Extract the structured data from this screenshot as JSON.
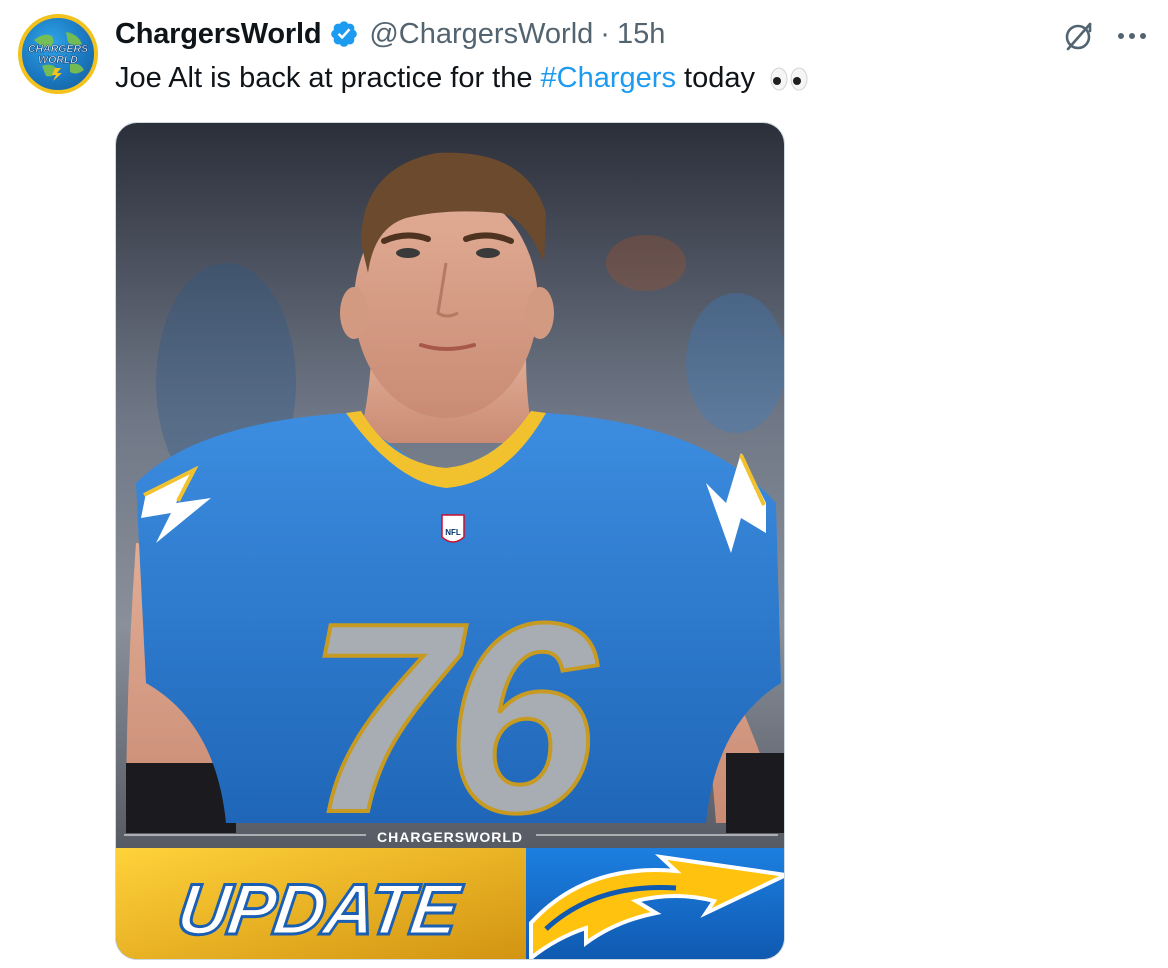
{
  "tweet": {
    "display_name": "ChargersWorld",
    "handle": "@ChargersWorld",
    "separator": "·",
    "time": "15h",
    "text_before": "Joe Alt is back at practice for the ",
    "hashtag": "#Chargers",
    "text_after": " today",
    "emoji": "eyes-emoji"
  },
  "avatar": {
    "line1": "CHARGERS",
    "line2": "WORLD",
    "icon": "globe-logo"
  },
  "icons": {
    "verified": "verified-badge-icon",
    "grok": "grok-icon",
    "more": "more-options-icon"
  },
  "media": {
    "jersey_number": "76",
    "watermark": "CHARGERSWORLD",
    "banner_text": "UPDATE",
    "badge": "NFL",
    "logo": "chargers-bolt-logo"
  },
  "colors": {
    "link": "#1d9bf0",
    "secondary_text": "#536471",
    "verified": "#1d9bf0",
    "jersey_blue": "#2f7fd6",
    "gold": "#f2b81c"
  }
}
